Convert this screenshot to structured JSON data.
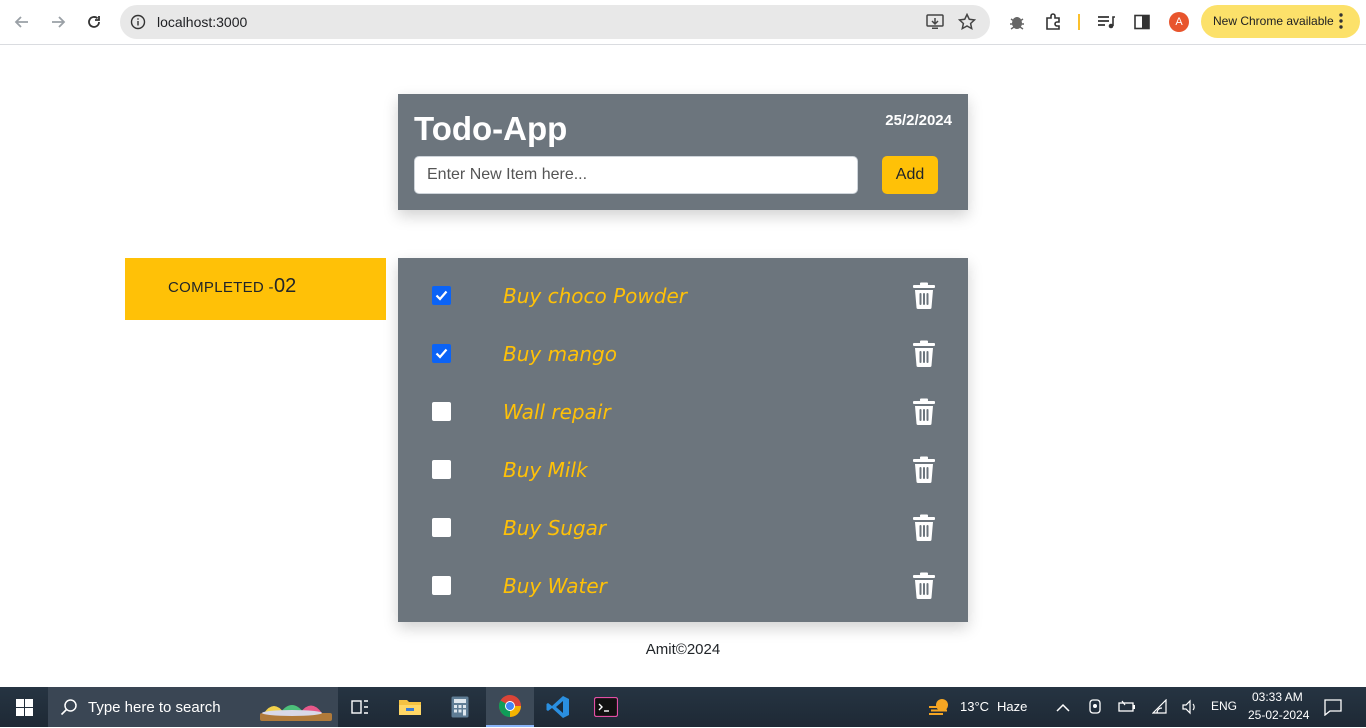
{
  "browser": {
    "url": "localhost:3000",
    "update_label": "New Chrome available",
    "profile_initial": "A"
  },
  "app": {
    "title": "Todo-App",
    "date": "25/2/2024",
    "input_placeholder": "Enter New Item here...",
    "add_label": "Add",
    "completed_label": "COMPLETED -",
    "completed_count": "02",
    "items": [
      {
        "label": "Buy choco Powder",
        "checked": true
      },
      {
        "label": "Buy mango",
        "checked": true
      },
      {
        "label": "Wall repair",
        "checked": false
      },
      {
        "label": "Buy Milk",
        "checked": false
      },
      {
        "label": "Buy Sugar",
        "checked": false
      },
      {
        "label": "Buy Water",
        "checked": false
      }
    ],
    "footer": "Amit©2024"
  },
  "taskbar": {
    "search_placeholder": "Type here to search",
    "weather_temp": "13°C",
    "weather_desc": "Haze",
    "language": "ENG",
    "time": "03:33 AM",
    "date": "25-02-2024"
  },
  "colors": {
    "card": "#6c757d",
    "accent": "#ffc107",
    "checkbox": "#0b63f6"
  }
}
